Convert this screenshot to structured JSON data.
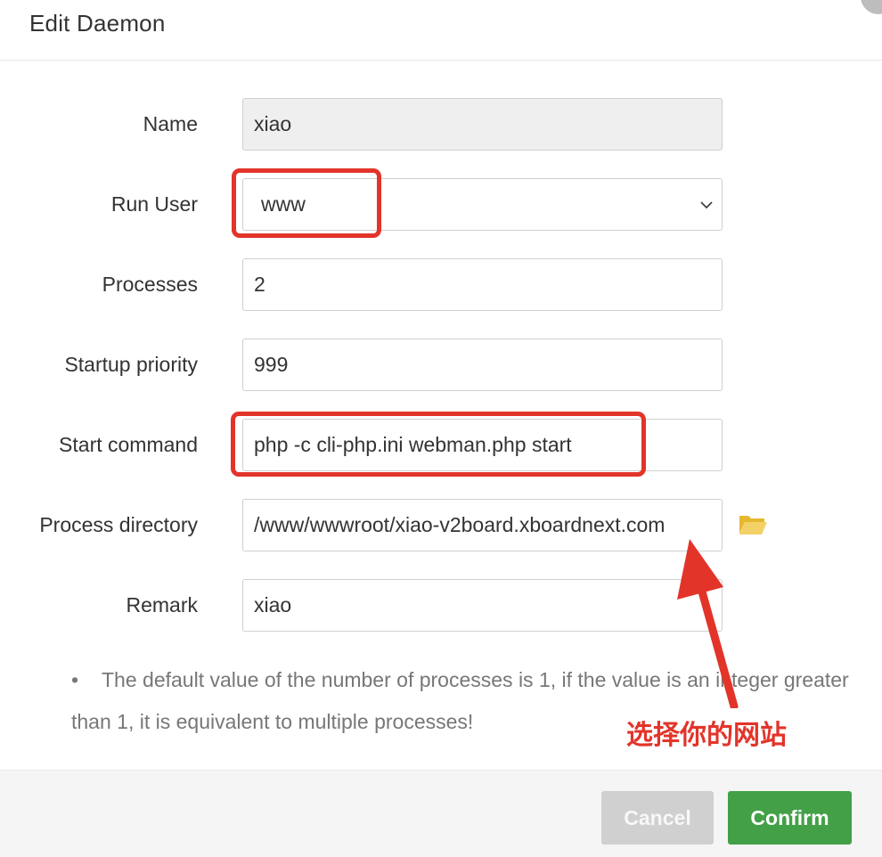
{
  "dialog": {
    "title": "Edit Daemon"
  },
  "form": {
    "name": {
      "label": "Name",
      "value": "xiao"
    },
    "run_user": {
      "label": "Run User",
      "value": "www"
    },
    "processes": {
      "label": "Processes",
      "value": "2"
    },
    "startup_priority": {
      "label": "Startup priority",
      "value": "999"
    },
    "start_command": {
      "label": "Start command",
      "value": "php -c cli-php.ini webman.php start"
    },
    "process_directory": {
      "label": "Process directory",
      "value": "/www/wwwroot/xiao-v2board.xboardnext.com"
    },
    "remark": {
      "label": "Remark",
      "value": "xiao"
    }
  },
  "note": {
    "bullet": "•",
    "text": "The default value of the number of processes is 1, if the value is an integer greater than 1, it is equivalent to multiple processes!"
  },
  "annotation": {
    "text": "选择你的网站",
    "color": "#e3342a"
  },
  "footer": {
    "cancel_label": "Cancel",
    "confirm_label": "Confirm"
  },
  "colors": {
    "confirm": "#43a047",
    "cancel": "#d0d0d0",
    "folder": "#f0c94a"
  },
  "icons": {
    "select": "chevron-down-icon",
    "directory": "folder-open-icon"
  }
}
